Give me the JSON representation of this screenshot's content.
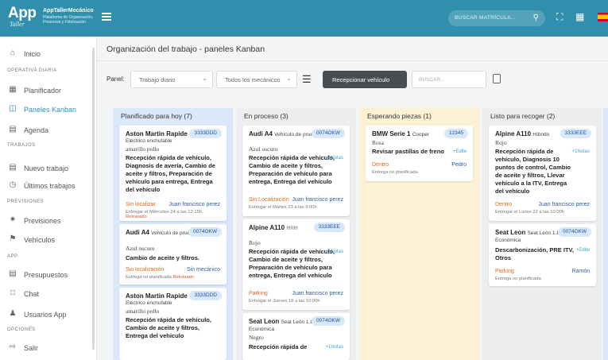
{
  "brand": {
    "logo_text": "App",
    "logo_sub": "Taller",
    "name": "AppTallerMecánico",
    "tagline": "Plataforma de Organización, Presencia y Fidelización"
  },
  "topbar": {
    "search_placeholder": "BUSCAR MATRÍCULA...",
    "icons": [
      "menu-icon",
      "search-icon",
      "expand-icon",
      "grid-icon",
      "flag-es-icon"
    ]
  },
  "sidebar": {
    "items": [
      {
        "label": "Inicio",
        "icon": "home-icon"
      },
      {
        "section": "OPERATIVA DIARIA"
      },
      {
        "label": "Planificador",
        "icon": "calendar-grid-icon"
      },
      {
        "label": "Paneles Kanban",
        "icon": "kanban-icon",
        "active": true
      },
      {
        "label": "Agenda",
        "icon": "agenda-icon"
      },
      {
        "section": "TRABAJOS"
      },
      {
        "label": "Nuevo trabajo",
        "icon": "new-job-icon"
      },
      {
        "label": "Últimos trabajos",
        "icon": "history-icon"
      },
      {
        "section": "PREVISIONES"
      },
      {
        "label": "Previsiones",
        "icon": "forecast-icon"
      },
      {
        "label": "Vehículos",
        "icon": "car-icon"
      },
      {
        "section": "APP"
      },
      {
        "label": "Presupuestos",
        "icon": "budget-icon"
      },
      {
        "label": "Chat",
        "icon": "chat-icon"
      },
      {
        "label": "Usuarios App",
        "icon": "users-icon"
      },
      {
        "section": "OPCIONES"
      },
      {
        "label": "Salir",
        "icon": "logout-icon"
      }
    ]
  },
  "page": {
    "title": "Organización del trabajo - paneles Kanban"
  },
  "filters": {
    "panel_label": "Panel:",
    "panel_value": "Trabajo diario",
    "mechanic_value": "Todos los mecánicos",
    "receive_button": "Recepcionar vehículo",
    "search_placeholder": "BUSCAR..."
  },
  "columns": [
    {
      "title": "Planificado para hoy (7)",
      "color": "#dbe8f9",
      "cards": [
        {
          "make": "Aston Martin Rapide",
          "model": "",
          "plate": "3333DDD",
          "sub": "Eléctrico enchufable",
          "color": "amarillo pollo",
          "desc": "Recepción rápida de vehículo, Diagnosis de avería, Cambio de aceite y filtros, Preparación de vehículo para entrega, Entrega del vehículo",
          "extra": "",
          "loc": "Sin localizar",
          "mech": "Juan francisco perez",
          "date": "Entregar el Miércoles 24 a las 12:15h",
          "late": "Retrasado"
        },
        {
          "make": "Audi A4",
          "model": "Vehículo de prueb...",
          "plate": "0074OKW",
          "sub": "",
          "color": "Azul oscuro",
          "desc": "Cambio de aceite y filtros.",
          "extra": "",
          "loc": "Sin localización",
          "mech": "Sin mecánico",
          "date": "Entrega no planificada",
          "late": "Retrasado"
        },
        {
          "make": "Aston Martin Rapide",
          "model": "",
          "plate": "3333DDD",
          "sub": "Eléctrico enchufable",
          "color": "amarillo pollo",
          "desc": "Recepción rápida de vehículo, Cambio de aceite y filtros, Entrega del vehículo",
          "extra": "",
          "loc": "",
          "mech": "",
          "date": "",
          "late": ""
        }
      ]
    },
    {
      "title": "En proceso (3)",
      "color": "#eceef0",
      "cards": [
        {
          "make": "Audi A4",
          "model": "Vehículo de prueb...",
          "plate": "0074OKW",
          "sub": "",
          "color": "Azul oscuro",
          "desc": "Recepción rápida de vehículo, Cambio de aceite y filtros, Preparación de vehículo para entrega, Entrega del vehículo",
          "extra": "+1Notas",
          "loc": "Sin Localización",
          "mech": "Juan francisco perez",
          "date": "Entregar el Martes 23 a las 9:00h",
          "late": ""
        },
        {
          "make": "Alpine A110",
          "model": "!!!!!!!!",
          "plate": "3333EEE",
          "sub": "",
          "color": "Rojo",
          "desc": "Recepción rápida de vehículo, Cambio de aceite y filtros, Preparación de vehículo para entrega, Entrega del vehículo",
          "extra": "+1Notas",
          "loc": "Parking",
          "mech": "Juan francisco perez",
          "date": "Entregar el Jueves 18 a las 10:00h",
          "late": ""
        },
        {
          "make": "Seat Leon",
          "model": "Seat León 1.8",
          "plate": "0074OKW",
          "sub": "Económica",
          "color": "Negro",
          "desc": "Recepción rápida de",
          "extra": "+1Notas",
          "loc": "",
          "mech": "",
          "date": "",
          "late": ""
        }
      ]
    },
    {
      "title": "Esperando piezas (1)",
      "color": "#fcf2d3",
      "cards": [
        {
          "make": "BMW Serie 1",
          "model": "Cooper",
          "plate": "12345",
          "sub": "",
          "color": "Rosa",
          "desc": "Revisar pastillas de freno",
          "extra": "+Edite",
          "loc": "Dentro",
          "mech": "Pedro",
          "date": "Entrega no planificada",
          "late": ""
        }
      ]
    },
    {
      "title": "Listo para recoger (2)",
      "color": "#eceef0",
      "cards": [
        {
          "make": "Alpine A110",
          "model": "Híbrido",
          "plate": "3333EEE",
          "sub": "",
          "color": "Rojo",
          "desc": "Recepción rápida de vehículo, Diagnosis 10 puntos de control, Cambio de aceite y filtros, Llevar vehículo a la ITV, Entrega del vehículo",
          "extra": "+1Notas",
          "loc": "Dentro",
          "mech": "Juan francisco perez",
          "date": "Entregar el Lunes 22 a las 10:00h",
          "late": ""
        },
        {
          "make": "Seat Leon",
          "model": "Seat León 1.8",
          "plate": "0074OKW",
          "sub": "Económica",
          "color": "",
          "desc": "Descarbonización, PRE ITV, Otros",
          "extra": "+Edite",
          "loc": "Parking",
          "mech": "Ramón",
          "date": "Entrega no planificada",
          "late": ""
        }
      ]
    }
  ]
}
